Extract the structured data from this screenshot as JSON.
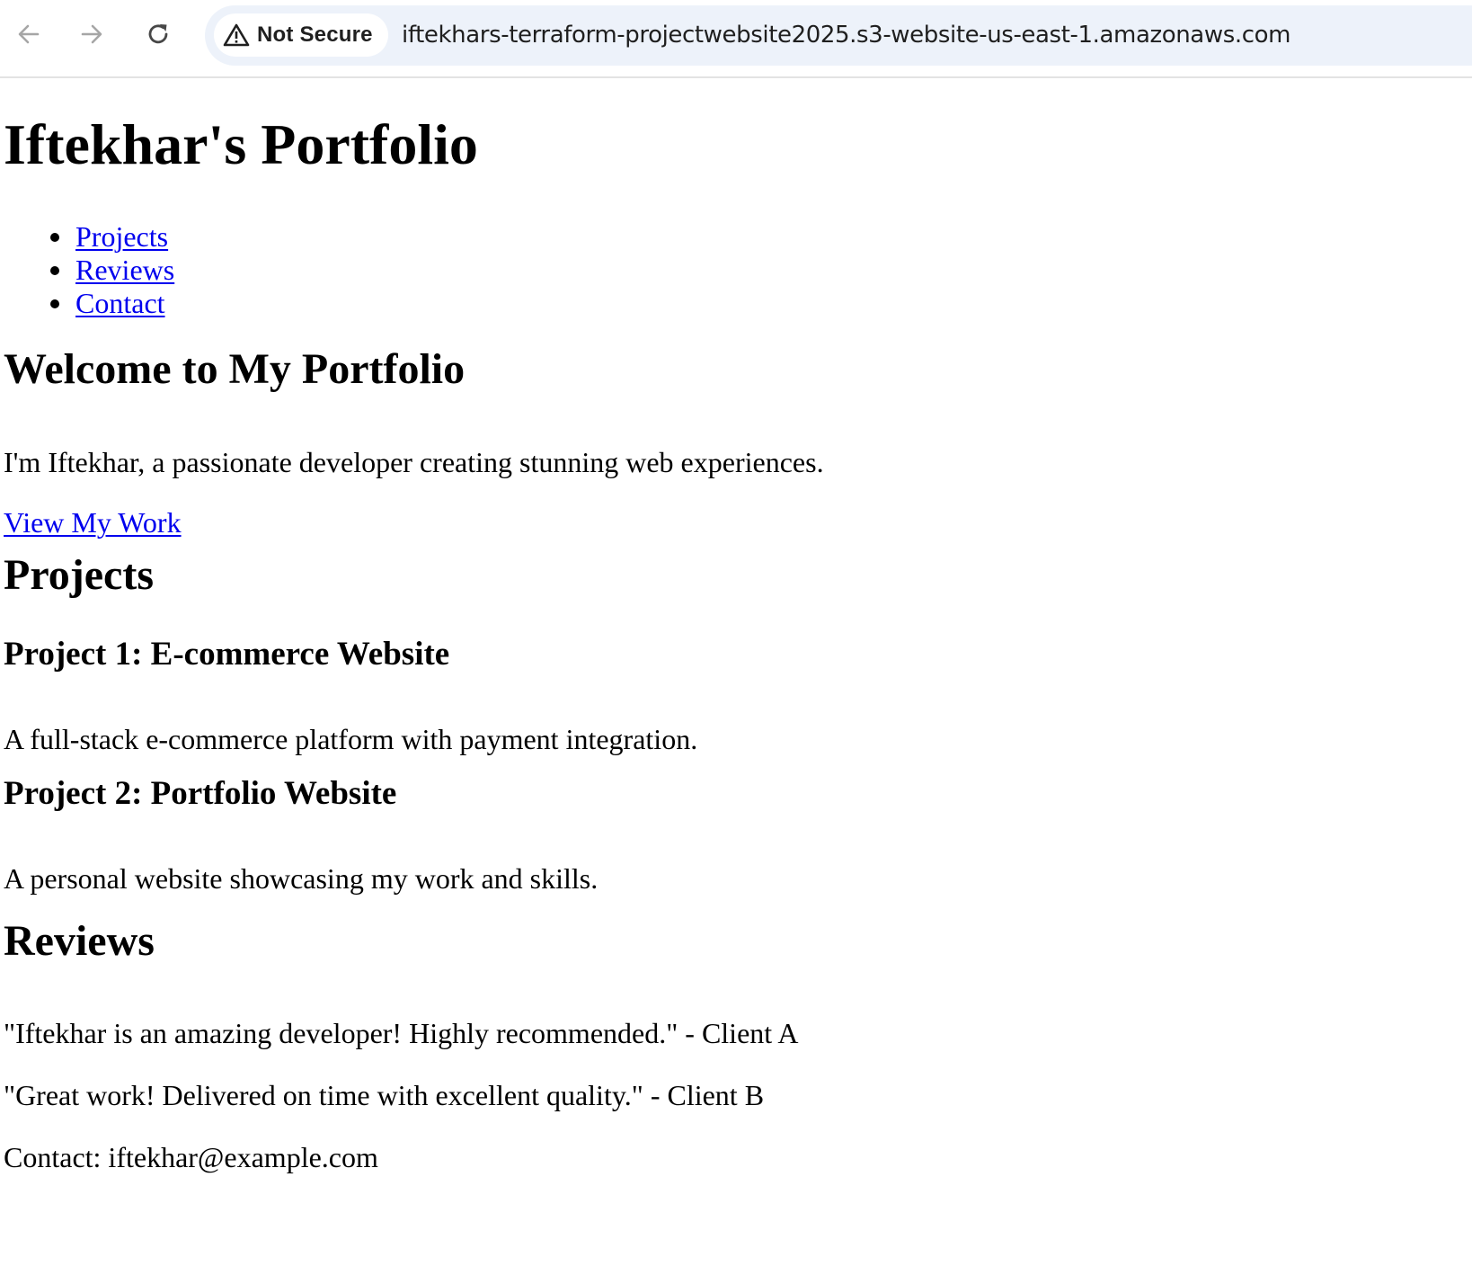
{
  "browser": {
    "back_icon": "arrow-left-icon",
    "forward_icon": "arrow-right-icon",
    "reload_icon": "reload-icon",
    "security_icon": "warning-triangle-icon",
    "security_label": "Not Secure",
    "url": "iftekhars-terraform-projectwebsite2025.s3-website-us-east-1.amazonaws.com",
    "omnibox_color": "#edf2fa"
  },
  "page": {
    "title": "Iftekhar's Portfolio",
    "nav": [
      {
        "label": "Projects"
      },
      {
        "label": "Reviews"
      },
      {
        "label": "Contact"
      }
    ],
    "hero": {
      "heading": "Welcome to My Portfolio",
      "intro": "I'm Iftekhar, a passionate developer creating stunning web experiences.",
      "cta": "View My Work"
    },
    "projects": {
      "heading": "Projects",
      "items": [
        {
          "title": "Project 1: E-commerce Website",
          "description": "A full-stack e-commerce platform with payment integration."
        },
        {
          "title": "Project 2: Portfolio Website",
          "description": "A personal website showcasing my work and skills."
        }
      ]
    },
    "reviews": {
      "heading": "Reviews",
      "items": [
        "\"Iftekhar is an amazing developer! Highly recommended.\" - Client A",
        "\"Great work! Delivered on time with excellent quality.\" - Client B"
      ]
    },
    "contact": "Contact: iftekhar@example.com",
    "link_color": "#0000ee"
  }
}
